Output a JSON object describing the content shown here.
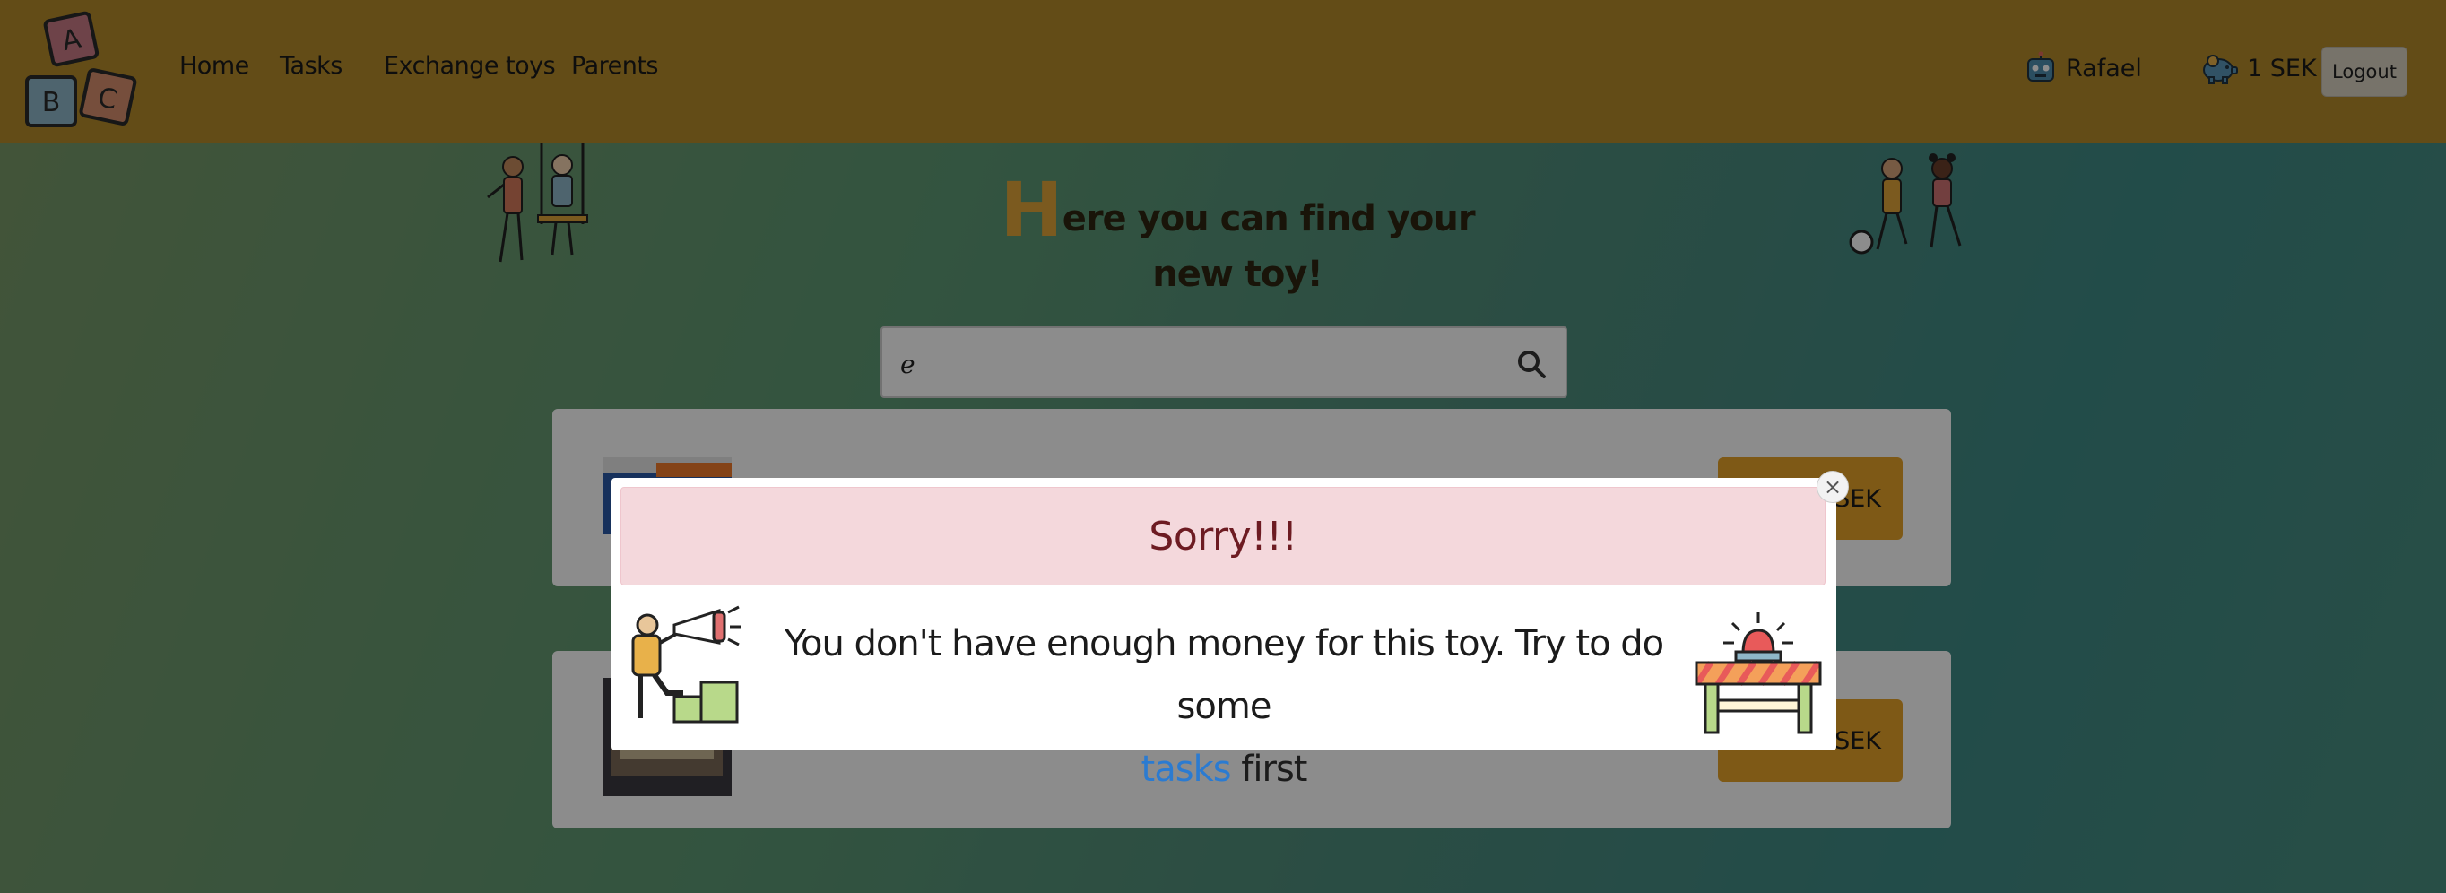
{
  "navbar": {
    "logo_letters": [
      "A",
      "B",
      "C"
    ],
    "links": [
      "Home",
      "Tasks",
      "Exchange toys",
      "Parents"
    ],
    "user_name": "Rafael",
    "balance": "1 SEK",
    "logout_label": "Logout"
  },
  "hero": {
    "title_first_letter": "H",
    "title_rest": "ere you can find your new toy!"
  },
  "search": {
    "value": "e",
    "placeholder": ""
  },
  "toys": [
    {
      "price_suffix": "SEK"
    },
    {
      "price_suffix": "SEK"
    }
  ],
  "modal": {
    "header": "Sorry!!!",
    "close_symbol": "×",
    "message_part1": "You don't have enough money for this toy. Try to do some",
    "link_text": "tasks",
    "message_part2": "first"
  },
  "colors": {
    "navbar": "#b58a2a",
    "accent": "#e5a229",
    "alert_bg": "#f4d8dc",
    "alert_text": "#6d1b22",
    "link": "#2b7bd1"
  },
  "icons": [
    "search-icon",
    "robot-icon",
    "piggy-bank-icon",
    "close-icon",
    "megaphone-person-icon",
    "siren-barrier-icon"
  ]
}
